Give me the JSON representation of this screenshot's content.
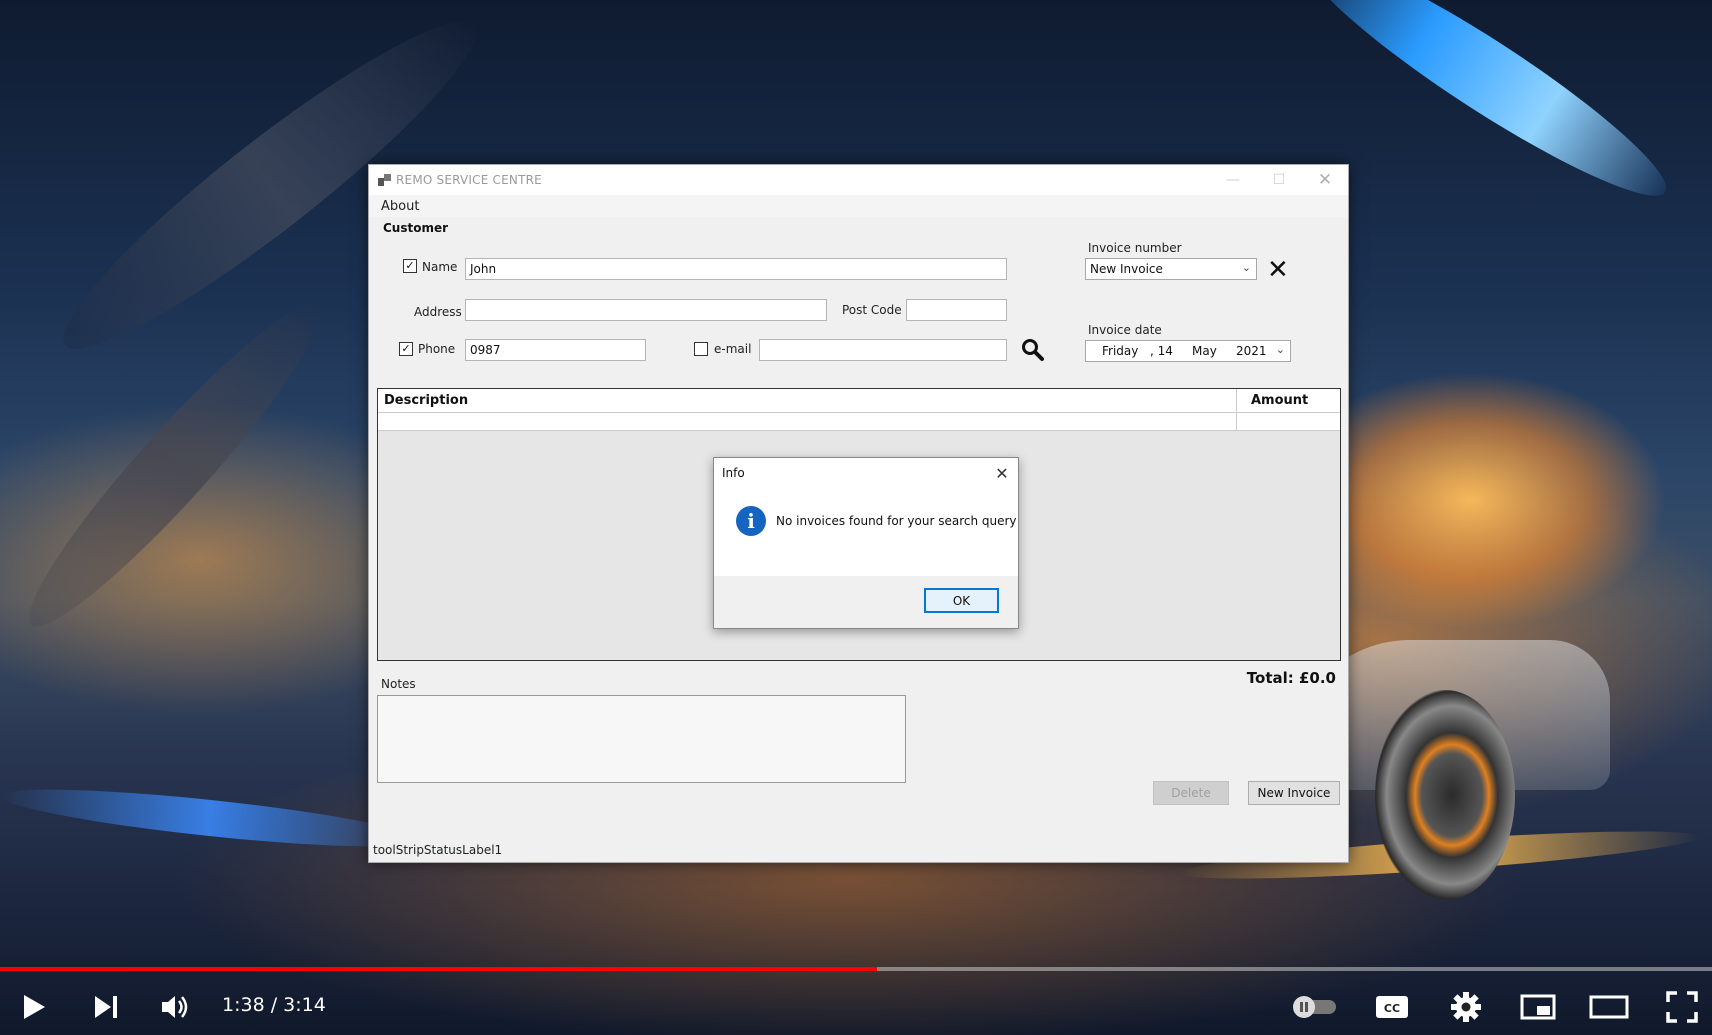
{
  "window": {
    "title": "REMO SERVICE CENTRE",
    "minimize": "—",
    "maximize": "☐",
    "close": "✕"
  },
  "menu": {
    "about": "About"
  },
  "customer": {
    "group_label": "Customer",
    "name_label": "Name",
    "name_checked": true,
    "name_value": "John",
    "address_label": "Address",
    "address_value": "",
    "postcode_label": "Post Code",
    "postcode_value": "",
    "phone_label": "Phone",
    "phone_checked": true,
    "phone_value": "0987",
    "email_label": "e-mail",
    "email_checked": false,
    "email_value": ""
  },
  "invoice": {
    "number_label": "Invoice number",
    "number_value": "New Invoice",
    "date_label": "Invoice date",
    "date_day": "Friday",
    "date_date": ", 14",
    "date_month": "May",
    "date_year": "2021"
  },
  "grid": {
    "col_description": "Description",
    "col_amount": "Amount"
  },
  "total": "Total: £0.0",
  "notes_label": "Notes",
  "buttons": {
    "delete": "Delete",
    "new_invoice": "New Invoice"
  },
  "status": "toolStripStatusLabel1",
  "dialog": {
    "title": "Info",
    "close": "✕",
    "icon": "i",
    "message": "No invoices found for your search query",
    "ok": "OK"
  },
  "player": {
    "time": "1:38 / 3:14",
    "progress": 0.512,
    "icons": [
      "play-icon",
      "next-icon",
      "volume-icon",
      "autoplay-toggle-icon",
      "captions-icon",
      "settings-icon",
      "miniplayer-icon",
      "theater-icon",
      "fullscreen-icon"
    ],
    "captions_label": "CC"
  }
}
